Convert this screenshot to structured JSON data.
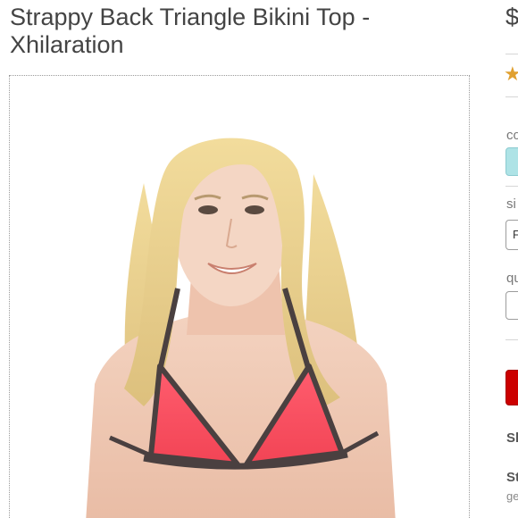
{
  "product": {
    "title": "Strappy Back Triangle Bikini Top - Xhilaration",
    "price": "$",
    "image_alt": "model wearing coral bikini top with dark trim"
  },
  "rating": {
    "star_icon": "star-icon",
    "star_color": "#e0a030"
  },
  "options": {
    "color_label": "co",
    "color_swatch_hex": "#aee3e6",
    "size_label": "si",
    "size_value": "F",
    "quantity_label": "qu"
  },
  "cart": {
    "button_color": "#cc0000"
  },
  "shipping": {
    "line1": "Sl",
    "line2": "St",
    "line2_sub": "ge"
  }
}
